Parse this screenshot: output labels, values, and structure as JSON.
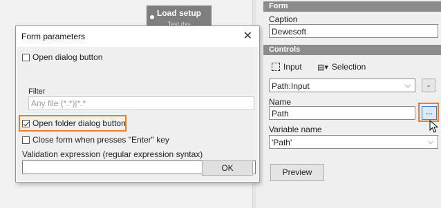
{
  "canvas": {
    "node": {
      "title": "Load setup",
      "subtitle": "Test.dxs"
    }
  },
  "dialog": {
    "title": "Form parameters",
    "close_glyph": "✕",
    "open_dialog_button": {
      "label": "Open dialog button",
      "checked": false
    },
    "filter_label": "Filter",
    "filter_value": "Any file (*.*)|*.*",
    "open_folder_dialog_button": {
      "label": "Open folder dialog button",
      "checked": true
    },
    "close_on_enter": {
      "label": "Close form when presses \"Enter\" key",
      "checked": false
    },
    "validation_label": "Validation expression (regular expression syntax)",
    "validation_value": "",
    "ok_label": "OK"
  },
  "panel": {
    "form_section": "Form",
    "caption_label": "Caption",
    "caption_value": "Dewesoft",
    "controls_section": "Controls",
    "input_tool": "Input",
    "selection_tool": "Selection",
    "control_select": "Path:Input",
    "remove_label": "-",
    "name_label": "Name",
    "name_value": "Path",
    "browse_label": "...",
    "variable_label": "Variable name",
    "variable_value": "'Path'",
    "preview_label": "Preview"
  },
  "colors": {
    "highlight": "#f07c2a",
    "section_header": "#8c8c8c",
    "node": "#7e7e7e"
  }
}
